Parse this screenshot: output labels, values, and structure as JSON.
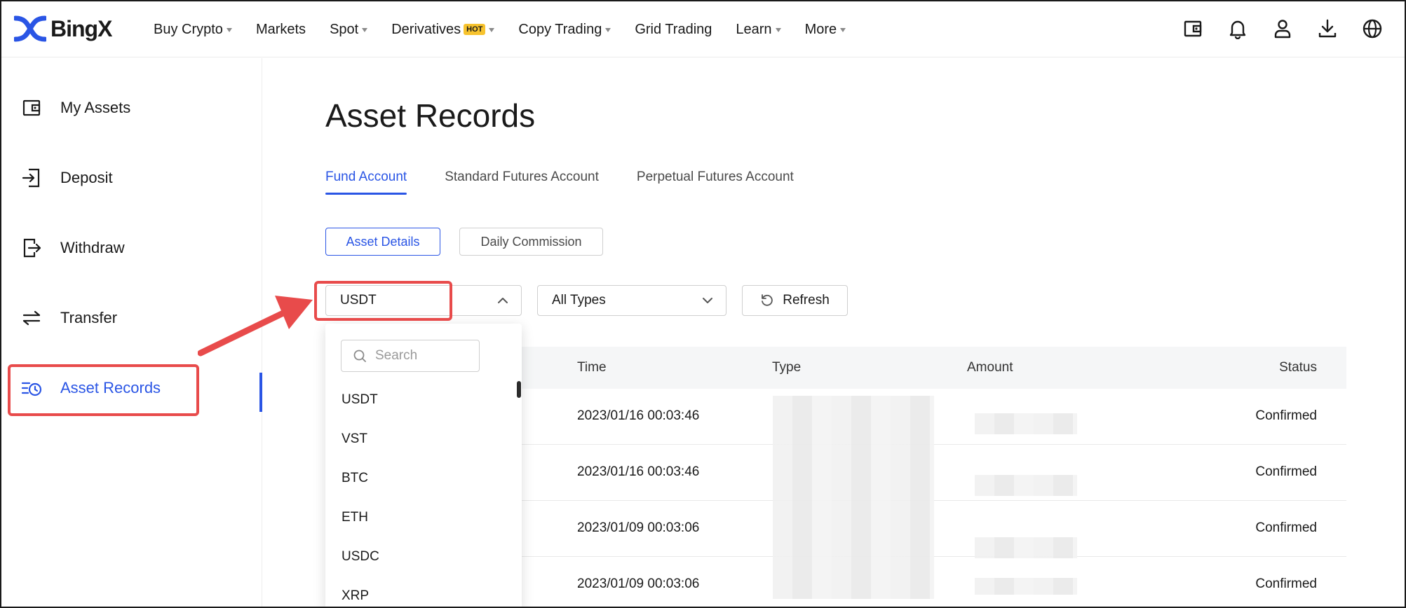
{
  "brand": {
    "name": "BingX",
    "accent": "#2a55e5",
    "hot_color": "#f7c32e",
    "annotation_color": "#e84b4b"
  },
  "nav": {
    "items": [
      {
        "label": "Buy Crypto",
        "caret": true
      },
      {
        "label": "Markets",
        "caret": false
      },
      {
        "label": "Spot",
        "caret": true
      },
      {
        "label": "Derivatives",
        "caret": true,
        "badge": "HOT"
      },
      {
        "label": "Copy Trading",
        "caret": true
      },
      {
        "label": "Grid Trading",
        "caret": false
      },
      {
        "label": "Learn",
        "caret": true
      },
      {
        "label": "More",
        "caret": true
      }
    ],
    "icons": [
      "wallet-icon",
      "bell-icon",
      "user-icon",
      "download-icon",
      "globe-icon"
    ]
  },
  "sidebar": {
    "items": [
      {
        "label": "My Assets",
        "icon": "wallet-icon"
      },
      {
        "label": "Deposit",
        "icon": "deposit-icon"
      },
      {
        "label": "Withdraw",
        "icon": "withdraw-icon"
      },
      {
        "label": "Transfer",
        "icon": "transfer-icon"
      },
      {
        "label": "Asset Records",
        "icon": "records-icon",
        "active": true
      }
    ]
  },
  "main": {
    "title": "Asset Records",
    "tabs": [
      "Fund Account",
      "Standard Futures Account",
      "Perpetual Futures Account"
    ],
    "subtabs": [
      "Asset Details",
      "Daily Commission"
    ],
    "filters": {
      "coin": "USDT",
      "type": "All Types",
      "refresh_label": "Refresh"
    },
    "table": {
      "headers": {
        "time": "Time",
        "type": "Type",
        "amount": "Amount",
        "status": "Status"
      },
      "rows": [
        {
          "time": "2023/01/16 00:03:46",
          "status": "Confirmed"
        },
        {
          "time": "2023/01/16 00:03:46",
          "status": "Confirmed"
        },
        {
          "time": "2023/01/09 00:03:06",
          "status": "Confirmed"
        },
        {
          "time": "2023/01/09 00:03:06",
          "status": "Confirmed"
        }
      ]
    },
    "dropdown": {
      "search_placeholder": "Search",
      "options": [
        "USDT",
        "VST",
        "BTC",
        "ETH",
        "USDC",
        "XRP"
      ]
    }
  }
}
